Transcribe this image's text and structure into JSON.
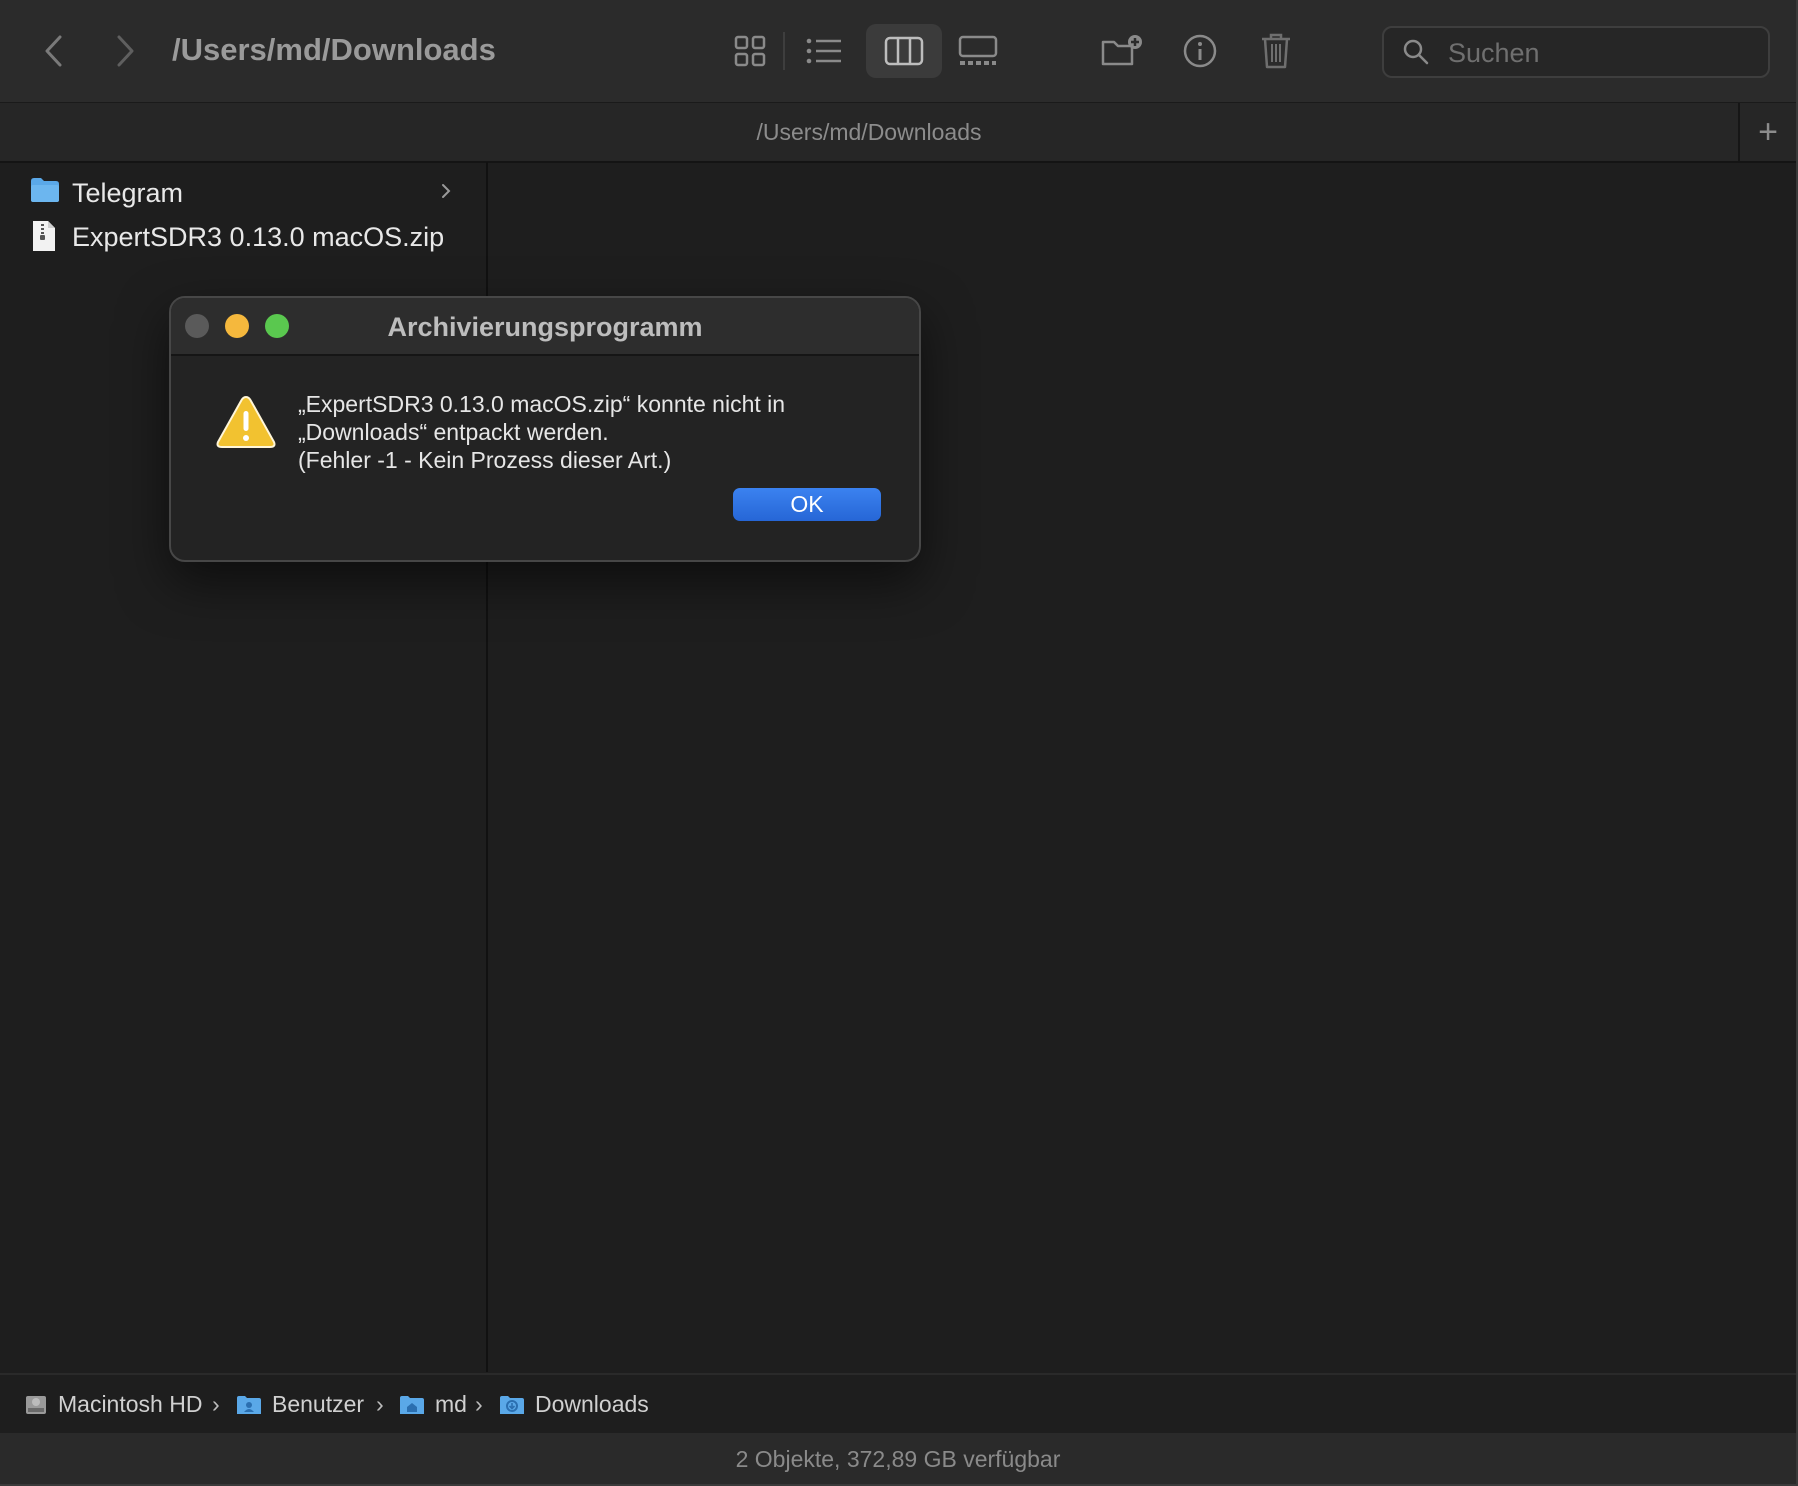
{
  "toolbar": {
    "title": "/Users/md/Downloads",
    "search_placeholder": "Suchen"
  },
  "tab": {
    "title": "/Users/md/Downloads",
    "add_label": "+"
  },
  "files": [
    {
      "name": "Telegram",
      "kind": "folder-icon"
    },
    {
      "name": "ExpertSDR3 0.13.0 macOS.zip",
      "kind": "document-icon"
    }
  ],
  "pathbar": {
    "items": [
      "Macintosh HD",
      "Benutzer",
      "md",
      "Downloads"
    ]
  },
  "status": "2 Objekte, 372,89 GB verfügbar",
  "dialog": {
    "title": "Archivierungsprogramm",
    "message_line1": "„ExpertSDR3 0.13.0 macOS.zip“ konnte nicht in",
    "message_line2": "„Downloads“ entpackt werden.",
    "message_line3": "(Fehler -1 - Kein Prozess dieser Art.)",
    "ok_label": "OK"
  },
  "colors": {
    "accent": "#2f74e6",
    "folder": "#5aa8e8",
    "close": "#5a5a5a",
    "minimize": "#f5b83d",
    "maximize": "#5ac84f",
    "warning": "#f2c230"
  }
}
